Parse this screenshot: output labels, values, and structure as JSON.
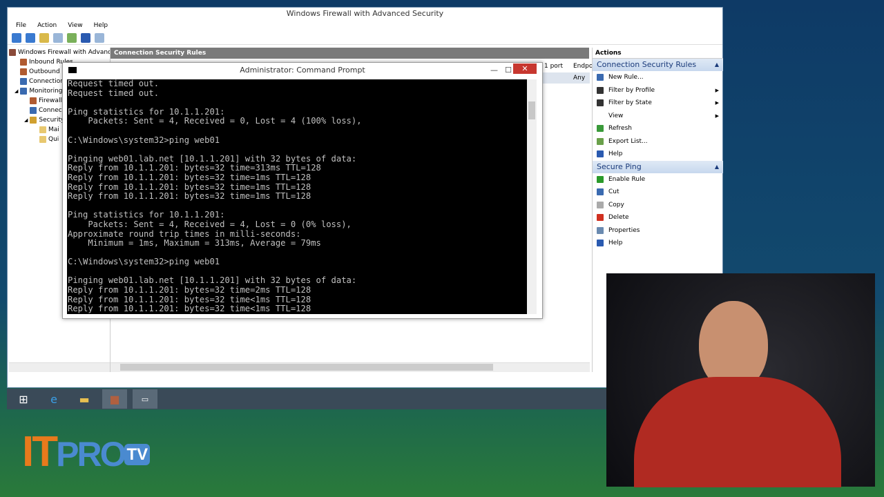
{
  "window": {
    "title": "Windows Firewall with Advanced Security",
    "menu": [
      "File",
      "Action",
      "View",
      "Help"
    ]
  },
  "tree": [
    "Windows Firewall with Advance",
    "Inbound Rules",
    "Outbound",
    "Connection",
    "Monitoring",
    "Firewall",
    "Connec",
    "Security",
    "Mai",
    "Qui"
  ],
  "center": {
    "header": "Connection Security Rules",
    "col1": "1 port",
    "col2": "Endpo",
    "cell": "Any"
  },
  "actions": {
    "title": "Actions",
    "section1": {
      "title": "Connection Security Rules",
      "items": [
        {
          "label": "New Rule...",
          "icon": "new-rule-icon"
        },
        {
          "label": "Filter by Profile",
          "icon": "filter-icon",
          "submenu": true
        },
        {
          "label": "Filter by State",
          "icon": "filter-icon",
          "submenu": true
        },
        {
          "label": "View",
          "icon": "",
          "submenu": true
        },
        {
          "label": "Refresh",
          "icon": "refresh-icon"
        },
        {
          "label": "Export List...",
          "icon": "export-icon"
        },
        {
          "label": "Help",
          "icon": "help-icon"
        }
      ]
    },
    "section2": {
      "title": "Secure Ping",
      "items": [
        {
          "label": "Enable Rule",
          "icon": "enable-icon"
        },
        {
          "label": "Cut",
          "icon": "cut-icon"
        },
        {
          "label": "Copy",
          "icon": "copy-icon"
        },
        {
          "label": "Delete",
          "icon": "delete-icon"
        },
        {
          "label": "Properties",
          "icon": "properties-icon"
        },
        {
          "label": "Help",
          "icon": "help-icon"
        }
      ]
    }
  },
  "cmd": {
    "title": "Administrator: Command Prompt",
    "lines": [
      "Request timed out.",
      "Request timed out.",
      "",
      "Ping statistics for 10.1.1.201:",
      "    Packets: Sent = 4, Received = 0, Lost = 4 (100% loss),",
      "",
      "C:\\Windows\\system32>ping web01",
      "",
      "Pinging web01.lab.net [10.1.1.201] with 32 bytes of data:",
      "Reply from 10.1.1.201: bytes=32 time=313ms TTL=128",
      "Reply from 10.1.1.201: bytes=32 time=1ms TTL=128",
      "Reply from 10.1.1.201: bytes=32 time=1ms TTL=128",
      "Reply from 10.1.1.201: bytes=32 time=1ms TTL=128",
      "",
      "Ping statistics for 10.1.1.201:",
      "    Packets: Sent = 4, Received = 4, Lost = 0 (0% loss),",
      "Approximate round trip times in milli-seconds:",
      "    Minimum = 1ms, Maximum = 313ms, Average = 79ms",
      "",
      "C:\\Windows\\system32>ping web01",
      "",
      "Pinging web01.lab.net [10.1.1.201] with 32 bytes of data:",
      "Reply from 10.1.1.201: bytes=32 time=2ms TTL=128",
      "Reply from 10.1.1.201: bytes=32 time<1ms TTL=128",
      "Reply from 10.1.1.201: bytes=32 time<1ms TTL=128"
    ]
  },
  "logo": {
    "text_it": "IT",
    "text_pro": "PRO",
    "text_tv": "TV"
  }
}
